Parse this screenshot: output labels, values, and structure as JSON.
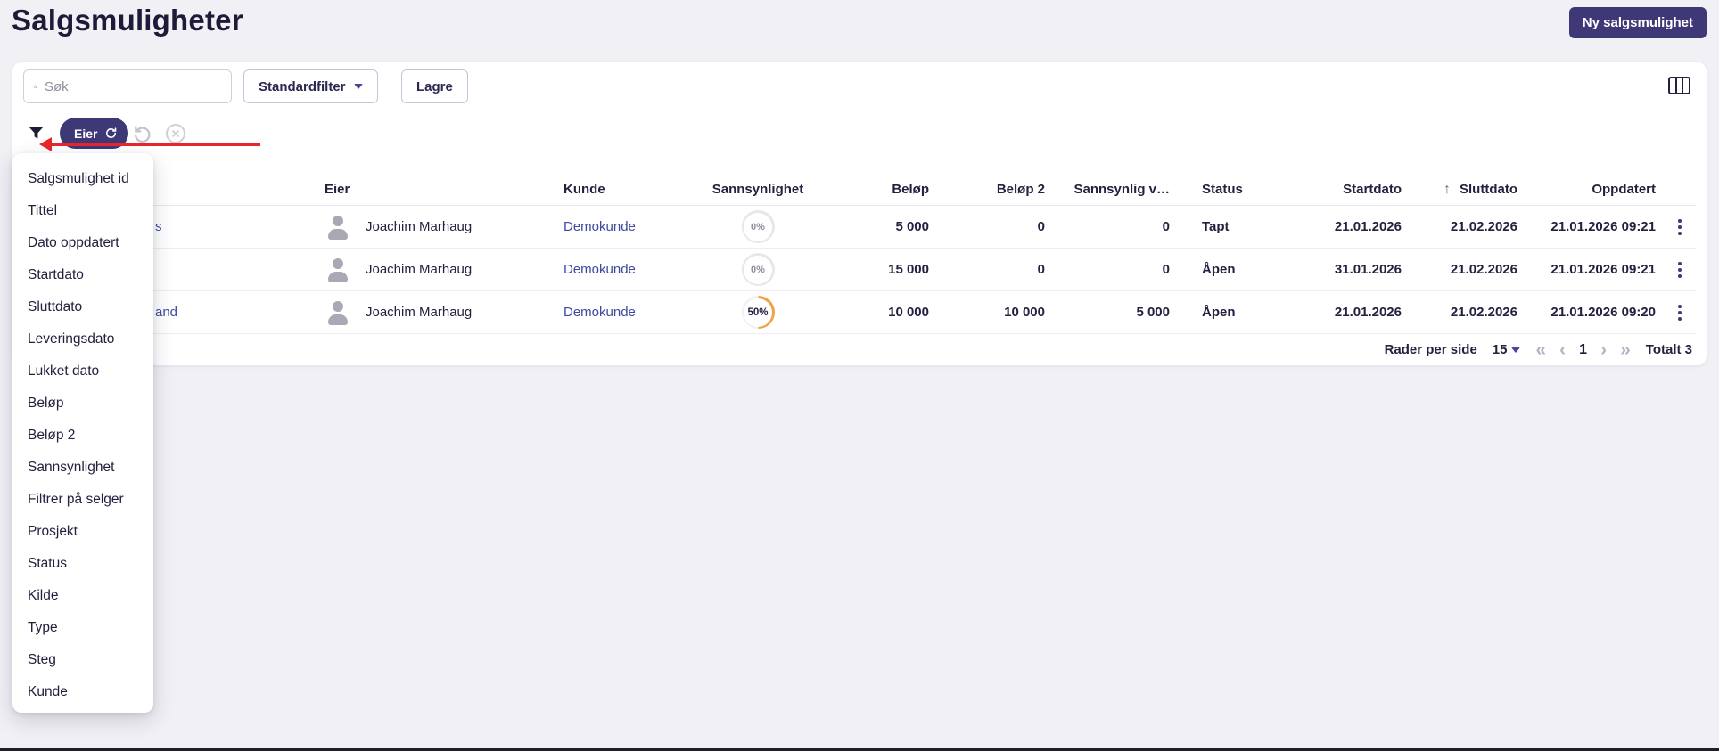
{
  "page": {
    "title": "Salgsmuligheter"
  },
  "header": {
    "new_opportunity_button": "Ny salgsmulighet"
  },
  "toolbar": {
    "search_placeholder": "Søk",
    "standard_filter_button": "Standardfilter",
    "save_button": "Lagre"
  },
  "filter_bar": {
    "active_filter": "Eier"
  },
  "filter_menu": {
    "items": [
      "Salgsmulighet id",
      "Tittel",
      "Dato oppdatert",
      "Startdato",
      "Sluttdato",
      "Leveringsdato",
      "Lukket dato",
      "Beløp",
      "Beløp 2",
      "Sannsynlighet",
      "Filtrer på selger",
      "Prosjekt",
      "Status",
      "Kilde",
      "Type",
      "Steg",
      "Kunde"
    ]
  },
  "table": {
    "headers": {
      "eier": "Eier",
      "kunde": "Kunde",
      "sannsynlighet": "Sannsynlighet",
      "belop": "Beløp",
      "belop2": "Beløp 2",
      "sannsynlig_verdi": "Sannsynlig v…",
      "status": "Status",
      "startdato": "Startdato",
      "sluttdato": "Sluttdato",
      "oppdatert": "Oppdatert"
    },
    "sorted_by": "Sluttdato",
    "sort_direction": "ascending",
    "rows": [
      {
        "title_fragment": "s",
        "owner": "Joachim Marhaug",
        "customer": "Demokunde",
        "probability": "0%",
        "amount": "5 000",
        "amount2": "0",
        "probable_value": "0",
        "status": "Tapt",
        "start_date": "21.01.2026",
        "end_date": "21.02.2026",
        "updated": "21.01.2026 09:21"
      },
      {
        "title_fragment": "",
        "owner": "Joachim Marhaug",
        "customer": "Demokunde",
        "probability": "0%",
        "amount": "15 000",
        "amount2": "0",
        "probable_value": "0",
        "status": "Åpen",
        "start_date": "31.01.2026",
        "end_date": "21.02.2026",
        "updated": "21.01.2026 09:21"
      },
      {
        "title_fragment": "and",
        "owner": "Joachim Marhaug",
        "customer": "Demokunde",
        "probability": "50%",
        "amount": "10 000",
        "amount2": "10 000",
        "probable_value": "5 000",
        "status": "Åpen",
        "start_date": "21.01.2026",
        "end_date": "21.02.2026",
        "updated": "21.01.2026 09:20"
      }
    ]
  },
  "pagination": {
    "rows_per_page_label": "Rader per side",
    "rows_per_page_value": "15",
    "current_page": "1",
    "total_label": "Totalt 3"
  },
  "colors": {
    "accent_purple": "#3e3877",
    "link_indigo": "#3c4a9f",
    "probability_orange": "#f0a24b",
    "annotation_red": "#e8252d"
  }
}
